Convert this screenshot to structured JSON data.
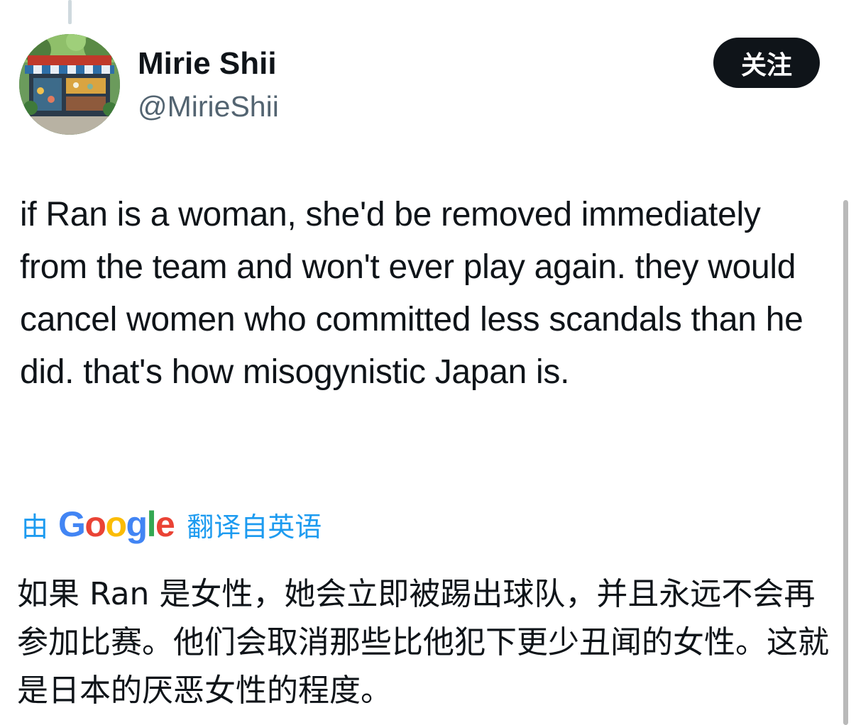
{
  "author": {
    "display_name": "Mirie Shii",
    "handle": "@MirieShii",
    "avatar_icon": "shop-front-illustration-avatar"
  },
  "follow_button": {
    "label": "关注"
  },
  "tweet": {
    "text": "if Ran is a woman, she'd be removed immediately from the team and won't ever play again. they would cancel women who committed less scandals than he did. that's how misogynistic Japan is."
  },
  "translation": {
    "prefix": "由",
    "provider": "Google",
    "suffix": "翻译自英语",
    "text": "如果 Ran 是女性，她会立即被踢出球队，并且永远不会再参加比赛。他们会取消那些比他犯下更少丑闻的女性。这就是日本的厌恶女性的程度。"
  },
  "colors": {
    "text": "#0f1419",
    "secondary_text": "#536471",
    "link_blue": "#1d9bf0",
    "button_bg": "#0f1419",
    "google_blue": "#4285f4",
    "google_red": "#ea4335",
    "google_yellow": "#fbbc05",
    "google_green": "#34a853"
  }
}
